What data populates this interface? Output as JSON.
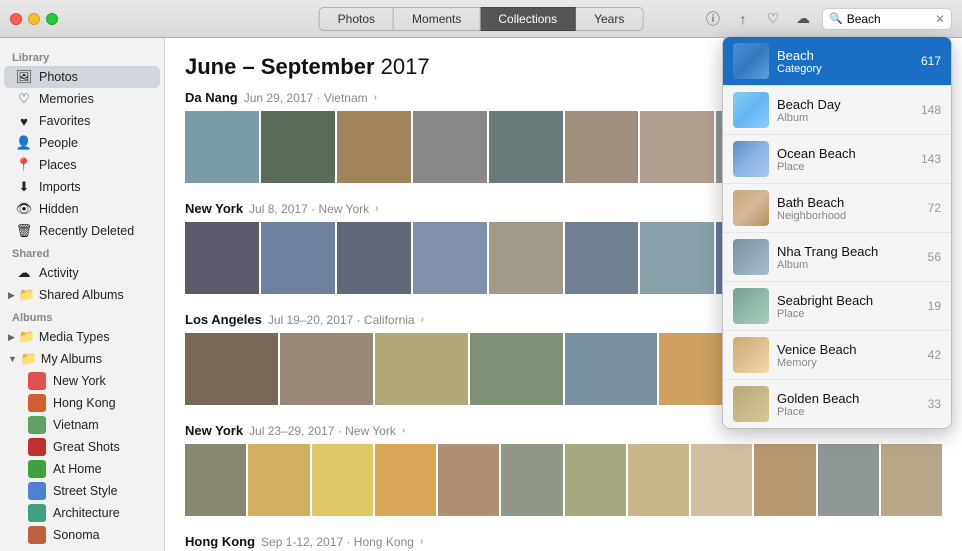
{
  "titlebar": {
    "nav_tabs": [
      {
        "id": "photos",
        "label": "Photos",
        "active": false
      },
      {
        "id": "moments",
        "label": "Moments",
        "active": false
      },
      {
        "id": "collections",
        "label": "Collections",
        "active": true
      },
      {
        "id": "years",
        "label": "Years",
        "active": false
      }
    ]
  },
  "sidebar": {
    "library_label": "Library",
    "library_items": [
      {
        "id": "photos",
        "label": "Photos",
        "icon": "🖼",
        "selected": true
      },
      {
        "id": "memories",
        "label": "Memories",
        "icon": "♡"
      },
      {
        "id": "favorites",
        "label": "Favorites",
        "icon": "♥"
      },
      {
        "id": "people",
        "label": "People",
        "icon": "👤"
      },
      {
        "id": "places",
        "label": "Places",
        "icon": "📍"
      },
      {
        "id": "imports",
        "label": "Imports",
        "icon": "⬇"
      },
      {
        "id": "hidden",
        "label": "Hidden",
        "icon": "👁"
      },
      {
        "id": "recently-deleted",
        "label": "Recently Deleted",
        "icon": "🗑"
      }
    ],
    "shared_label": "Shared",
    "shared_items": [
      {
        "id": "activity",
        "label": "Activity",
        "icon": "☁"
      },
      {
        "id": "shared-albums",
        "label": "Shared Albums",
        "icon": "📁",
        "group": true
      }
    ],
    "albums_label": "Albums",
    "albums_groups": [
      {
        "id": "media-types",
        "label": "Media Types",
        "expanded": false
      },
      {
        "id": "my-albums",
        "label": "My Albums",
        "expanded": true
      }
    ],
    "album_items": [
      {
        "id": "new-york",
        "label": "New York",
        "color": "#e05050"
      },
      {
        "id": "hong-kong",
        "label": "Hong Kong",
        "color": "#d06030"
      },
      {
        "id": "vietnam",
        "label": "Vietnam",
        "color": "#60a060"
      },
      {
        "id": "great-shots",
        "label": "Great Shots",
        "color": "#c03030"
      },
      {
        "id": "at-home",
        "label": "At Home",
        "color": "#40a040"
      },
      {
        "id": "street-style",
        "label": "Street Style",
        "color": "#5080d0"
      },
      {
        "id": "architecture",
        "label": "Architecture",
        "color": "#40a080"
      },
      {
        "id": "sonoma",
        "label": "Sonoma",
        "color": "#c06040"
      }
    ]
  },
  "content": {
    "period": "June – September",
    "year": "2017",
    "sections": [
      {
        "id": "danang",
        "title": "Da Nang",
        "date": "Jun 29, 2017",
        "location": "Vietnam",
        "has_arrow": true,
        "strip_class": "strip-danang",
        "cells": 10
      },
      {
        "id": "ny1",
        "title": "New York",
        "date": "Jul 8, 2017",
        "location": "New York",
        "has_arrow": true,
        "strip_class": "strip-ny1",
        "cells": 10
      },
      {
        "id": "la",
        "title": "Los Angeles",
        "date": "Jul 19–20, 2017",
        "location": "California",
        "has_arrow": true,
        "strip_class": "strip-la",
        "cells": 8
      },
      {
        "id": "ny2",
        "title": "New York",
        "date": "Jul 23–29, 2017",
        "location": "New York",
        "has_arrow": true,
        "strip_class": "strip-ny2",
        "cells": 12
      },
      {
        "id": "hongkong",
        "title": "Hong Kong",
        "date": "Sep 1-12, 2017",
        "location": "Hong Kong",
        "has_arrow": true,
        "strip_class": "strip-ny2",
        "cells": 8
      }
    ]
  },
  "search": {
    "value": "Beach",
    "placeholder": "Search"
  },
  "dropdown": {
    "items": [
      {
        "id": "beach-cat",
        "name": "Beach",
        "sub": "Category",
        "count": "617",
        "thumb": "thumb-beach",
        "highlighted": true
      },
      {
        "id": "beach-day",
        "name": "Beach Day",
        "sub": "Album",
        "count": "148",
        "thumb": "thumb-beachday",
        "highlighted": false
      },
      {
        "id": "ocean-beach",
        "name": "Ocean Beach",
        "sub": "Place",
        "count": "143",
        "thumb": "thumb-oceanbeach",
        "highlighted": false
      },
      {
        "id": "bath-beach",
        "name": "Bath Beach",
        "sub": "Neighborhood",
        "count": "72",
        "thumb": "thumb-bathbeach",
        "highlighted": false
      },
      {
        "id": "nha-trang",
        "name": "Nha Trang Beach",
        "sub": "Album",
        "count": "56",
        "thumb": "thumb-nhatrang",
        "highlighted": false
      },
      {
        "id": "seabright",
        "name": "Seabright Beach",
        "sub": "Place",
        "count": "19",
        "thumb": "thumb-seabright",
        "highlighted": false
      },
      {
        "id": "venice",
        "name": "Venice Beach",
        "sub": "Memory",
        "count": "42",
        "thumb": "thumb-venice",
        "highlighted": false
      },
      {
        "id": "golden",
        "name": "Golden Beach",
        "sub": "Place",
        "count": "33",
        "thumb": "thumb-golden",
        "highlighted": false
      }
    ]
  },
  "icons": {
    "info": "ⓘ",
    "share": "↑",
    "heart": "♡",
    "icloud": "☁",
    "search": "🔍",
    "clear": "✕"
  }
}
